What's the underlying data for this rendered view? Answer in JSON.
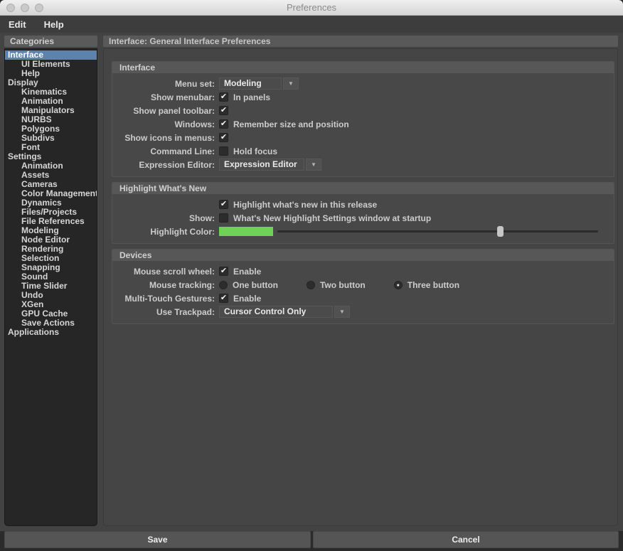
{
  "window": {
    "title": "Preferences"
  },
  "menubar": {
    "items": [
      "Edit",
      "Help"
    ]
  },
  "sidebar": {
    "header": "Categories",
    "items": [
      {
        "label": "Interface",
        "level": 0,
        "selected": true
      },
      {
        "label": "UI Elements",
        "level": 1
      },
      {
        "label": "Help",
        "level": 1
      },
      {
        "label": "Display",
        "level": 0
      },
      {
        "label": "Kinematics",
        "level": 1
      },
      {
        "label": "Animation",
        "level": 1
      },
      {
        "label": "Manipulators",
        "level": 1
      },
      {
        "label": "NURBS",
        "level": 1
      },
      {
        "label": "Polygons",
        "level": 1
      },
      {
        "label": "Subdivs",
        "level": 1
      },
      {
        "label": "Font",
        "level": 1
      },
      {
        "label": "Settings",
        "level": 0
      },
      {
        "label": "Animation",
        "level": 1
      },
      {
        "label": "Assets",
        "level": 1
      },
      {
        "label": "Cameras",
        "level": 1
      },
      {
        "label": "Color Management",
        "level": 1
      },
      {
        "label": "Dynamics",
        "level": 1
      },
      {
        "label": "Files/Projects",
        "level": 1
      },
      {
        "label": "File References",
        "level": 1
      },
      {
        "label": "Modeling",
        "level": 1
      },
      {
        "label": "Node Editor",
        "level": 1
      },
      {
        "label": "Rendering",
        "level": 1
      },
      {
        "label": "Selection",
        "level": 1
      },
      {
        "label": "Snapping",
        "level": 1
      },
      {
        "label": "Sound",
        "level": 1
      },
      {
        "label": "Time Slider",
        "level": 1
      },
      {
        "label": "Undo",
        "level": 1
      },
      {
        "label": "XGen",
        "level": 1
      },
      {
        "label": "GPU Cache",
        "level": 1
      },
      {
        "label": "Save Actions",
        "level": 1
      },
      {
        "label": "Applications",
        "level": 0
      }
    ]
  },
  "main": {
    "header": "Interface: General Interface Preferences",
    "sections": {
      "interface": {
        "title": "Interface",
        "rows": {
          "menu_set": {
            "label": "Menu set:",
            "value": "Modeling"
          },
          "show_menubar": {
            "label": "Show menubar:",
            "check": "✔",
            "text": "In panels"
          },
          "show_panel_toolbar": {
            "label": "Show panel toolbar:",
            "check": "✔",
            "text": ""
          },
          "windows": {
            "label": "Windows:",
            "check": "✔",
            "text": "Remember size and position"
          },
          "show_icons": {
            "label": "Show icons in menus:",
            "check": "✔",
            "text": ""
          },
          "command_line": {
            "label": "Command Line:",
            "check": "",
            "text": "Hold focus"
          },
          "expression_editor": {
            "label": "Expression Editor:",
            "value": "Expression Editor"
          }
        }
      },
      "highlight": {
        "title": "Highlight What's New",
        "rows": {
          "highlight_new": {
            "label": "",
            "check": "✔",
            "text": "Highlight what's new in this release"
          },
          "show": {
            "label": "Show:",
            "check": "",
            "text": "What's New Highlight Settings window at startup"
          },
          "highlight_color": {
            "label": "Highlight Color:",
            "color": "#6fd155",
            "slider_percent": 69.5
          }
        }
      },
      "devices": {
        "title": "Devices",
        "rows": {
          "mouse_scroll": {
            "label": "Mouse scroll wheel:",
            "check": "✔",
            "text": "Enable"
          },
          "mouse_tracking": {
            "label": "Mouse tracking:",
            "options": [
              {
                "label": "One button",
                "dot": ""
              },
              {
                "label": "Two button",
                "dot": ""
              },
              {
                "label": "Three button",
                "dot": "●"
              }
            ]
          },
          "multi_touch": {
            "label": "Multi-Touch Gestures:",
            "check": "✔",
            "text": "Enable"
          },
          "use_trackpad": {
            "label": "Use Trackpad:",
            "value": "Cursor Control Only"
          }
        }
      }
    }
  },
  "footer": {
    "save": "Save",
    "cancel": "Cancel"
  },
  "icons": {
    "chevron_down": "▼",
    "check": "✔",
    "radio_dot": "●"
  },
  "colors": {
    "selection_blue": "#5d83ac",
    "highlight_green": "#6fd155"
  }
}
